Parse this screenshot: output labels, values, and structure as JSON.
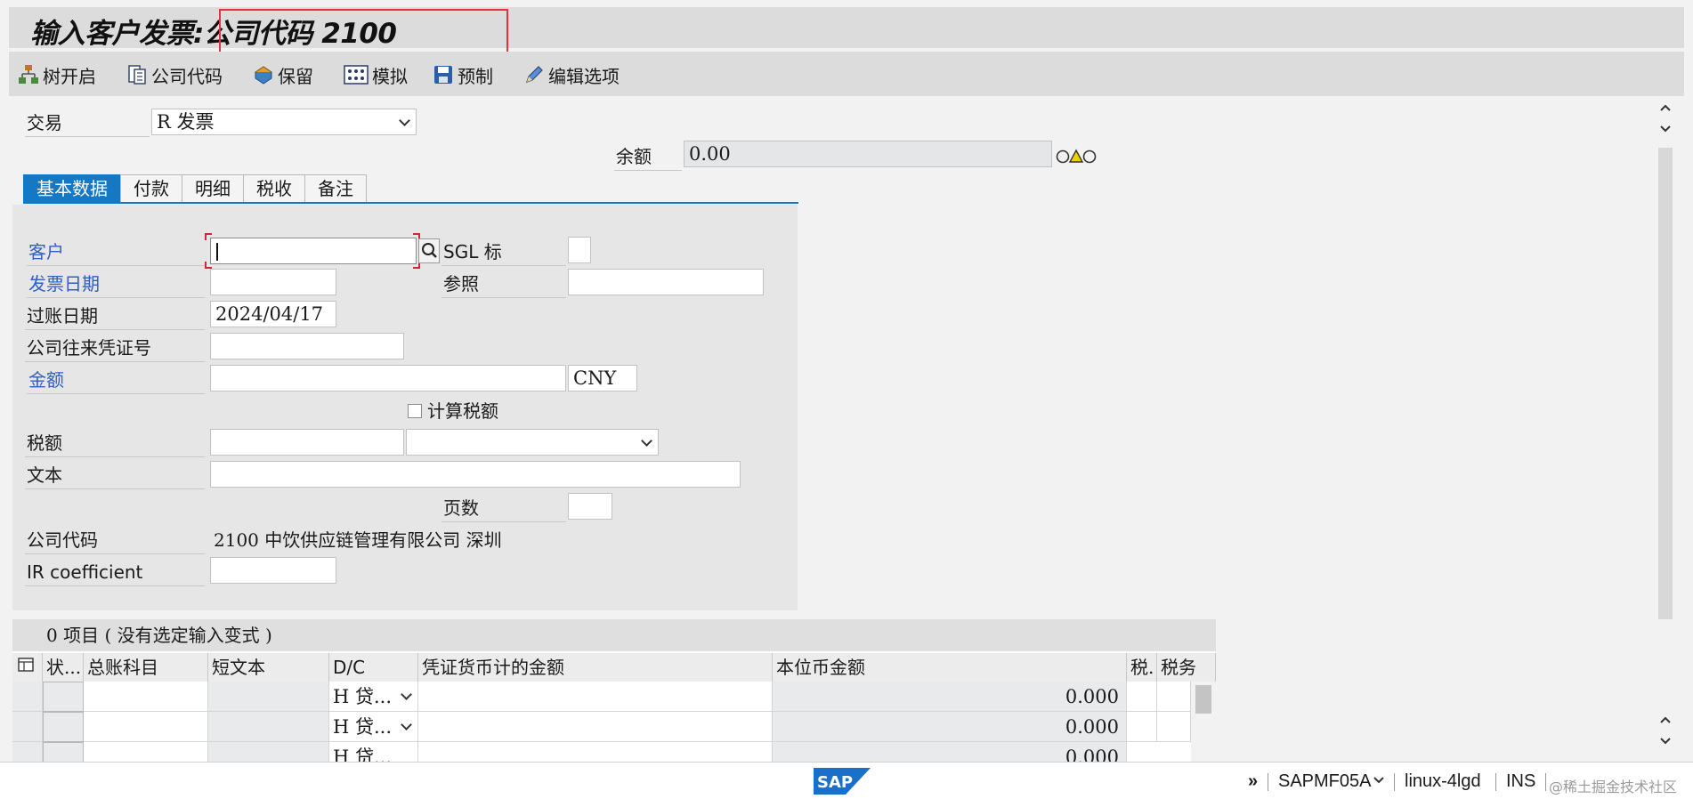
{
  "title": {
    "text": "输入客户发票:公司代码 2100"
  },
  "toolbar": {
    "tree_on": "树开启",
    "company_code": "公司代码",
    "hold": "保留",
    "simulate": "模拟",
    "park": "预制",
    "edit_options": "编辑选项"
  },
  "transaction": {
    "label": "交易",
    "value": "R 发票"
  },
  "balance": {
    "label": "余额",
    "value": "0.00"
  },
  "tabs": [
    {
      "label": "基本数据"
    },
    {
      "label": "付款"
    },
    {
      "label": "明细"
    },
    {
      "label": "税收"
    },
    {
      "label": "备注"
    }
  ],
  "form": {
    "customer_label": "客户",
    "customer_value": "",
    "sgl_label": "SGL 标",
    "invoice_date_label": "发票日期",
    "reference_label": "参照",
    "posting_date_label": "过账日期",
    "posting_date_value": "2024/04/17",
    "intercompany_label": "公司往来凭证号",
    "amount_label": "金额",
    "currency_value": "CNY",
    "calc_tax_label": "计算税额",
    "tax_amount_label": "税额",
    "text_label": "文本",
    "pages_label": "页数",
    "company_code_label": "公司代码",
    "company_code_value": "2100 中饮供应链管理有限公司 深圳",
    "ir_label": "IR coefficient"
  },
  "grid": {
    "header": "0 项目 ( 没有选定输入变式 )",
    "columns": [
      "状...",
      "总账科目",
      "短文本",
      "D/C",
      "凭证货币计的金额",
      "本位币金额",
      "税.",
      "税务"
    ],
    "rows": [
      {
        "dc": "H 贷...",
        "local_amount": "0.000"
      },
      {
        "dc": "H 贷...",
        "local_amount": "0.000"
      },
      {
        "dc": "H 贷...",
        "local_amount": "0.000"
      }
    ]
  },
  "status": {
    "program": "SAPMF05A",
    "server": "linux-4lgd",
    "mode": "INS",
    "watermark": "@稀土掘金技术社区"
  },
  "colors": {
    "accent": "#1578c5",
    "required_label": "#2f5fc4",
    "highlight": "#e2323a"
  }
}
